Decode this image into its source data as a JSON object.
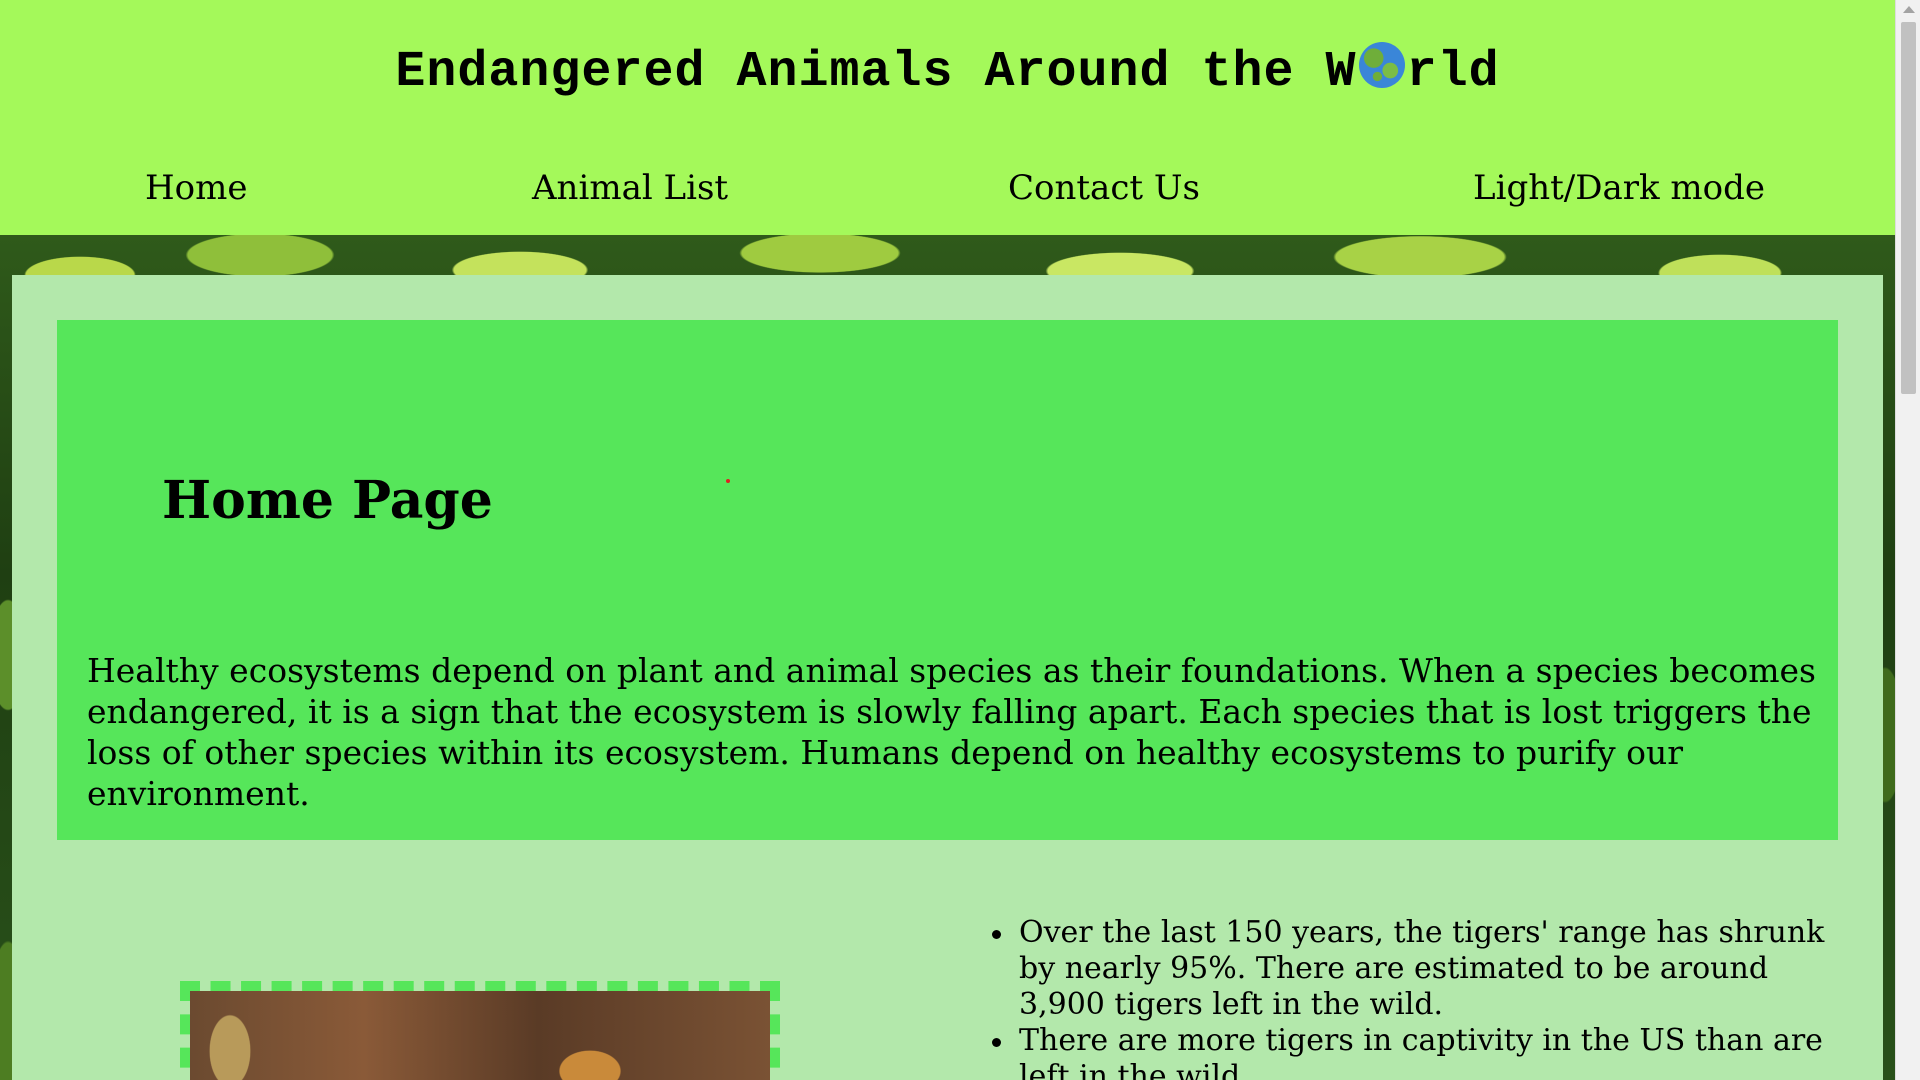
{
  "header": {
    "title_before": "Endangered Animals Around the W",
    "title_after": "rld",
    "globe_icon": "globe-emoji-icon"
  },
  "nav": {
    "items": [
      {
        "label": "Home"
      },
      {
        "label": "Animal List"
      },
      {
        "label": "Contact Us"
      },
      {
        "label": "Light/Dark mode"
      }
    ]
  },
  "hero": {
    "title": "Home Page",
    "text": "Healthy ecosystems depend on plant and animal species as their foundations. When a species becomes endangered, it is a sign that the ecosystem is slowly falling apart. Each species that is lost triggers the loss of other species within its ecosystem. Humans depend on healthy ecosystems to purify our environment."
  },
  "facts": [
    "Over the last 150 years, the tigers' range has shrunk by nearly 95%. There are estimated to be around 3,900 tigers left in the wild.",
    "There are more tigers in captivity in the US than are left in the wild."
  ],
  "colors": {
    "header_bg": "#a4f95a",
    "panel_bg": "#b3e8ab",
    "hero_bg": "#56e65a"
  }
}
